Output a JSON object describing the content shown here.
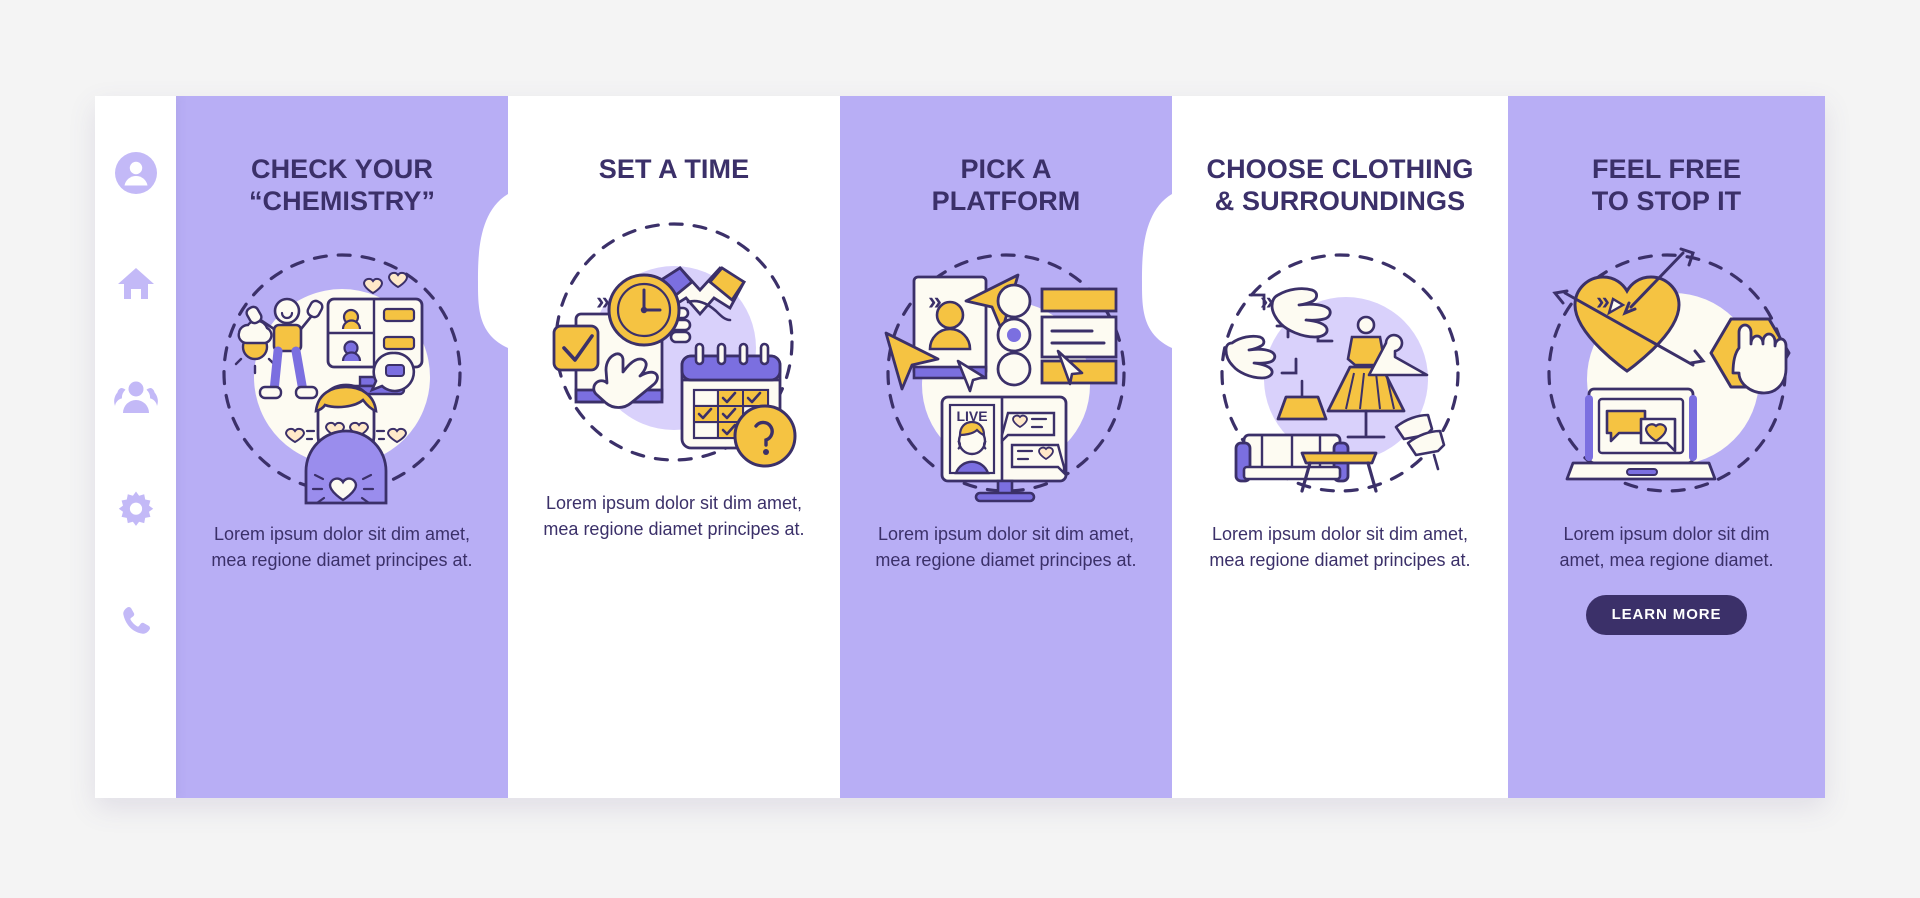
{
  "colors": {
    "page_bg": "#f4f4f4",
    "panel_purple": "#b8aef5",
    "panel_white": "#ffffff",
    "text_dark": "#3b3069",
    "accent_yellow": "#f5c342",
    "accent_purple": "#7b6fe0",
    "rail_icon": "#c3b9f7"
  },
  "sidebar": {
    "items": [
      {
        "name": "avatar-icon",
        "label": "Profile"
      },
      {
        "name": "home-icon",
        "label": "Home"
      },
      {
        "name": "people-icon",
        "label": "Community"
      },
      {
        "name": "gear-icon",
        "label": "Settings"
      },
      {
        "name": "phone-icon",
        "label": "Contact"
      }
    ]
  },
  "separator": {
    "glyph": "»"
  },
  "panels": [
    {
      "title": "CHECK YOUR\n“CHEMISTRY”",
      "title_line1": "CHECK YOUR",
      "title_line2": "“CHEMISTRY”",
      "desc": "Lorem ipsum dolor sit dim amet, mea regione diamet principes at.",
      "background": "purple",
      "art": "chemistry-illustration",
      "active_dot": 1,
      "dot_count": 5,
      "button": null
    },
    {
      "title": "SET A TIME",
      "title_line1": "SET A TIME",
      "title_line2": "",
      "desc": "Lorem ipsum dolor sit dim amet, mea regione diamet principes at.",
      "background": "white",
      "art": "set-a-time-illustration",
      "active_dot": 2,
      "dot_count": 5,
      "button": null
    },
    {
      "title": "PICK A\nPLATFORM",
      "title_line1": "PICK A",
      "title_line2": "PLATFORM",
      "desc": "Lorem ipsum dolor sit dim amet, mea regione diamet principes at.",
      "background": "purple",
      "art": "pick-a-platform-illustration",
      "active_dot": 3,
      "dot_count": 5,
      "button": null
    },
    {
      "title": "CHOOSE CLOTHING\n& SURROUNDINGS",
      "title_line1": "CHOOSE CLOTHING",
      "title_line2": "& SURROUNDINGS",
      "desc": "Lorem ipsum dolor sit dim amet, mea regione diamet principes at.",
      "background": "white",
      "art": "choose-clothing-illustration",
      "active_dot": 4,
      "dot_count": 5,
      "button": null
    },
    {
      "title": "FEEL FREE\nTO STOP IT",
      "title_line1": "FEEL FREE",
      "title_line2": "TO STOP IT",
      "desc": "Lorem ipsum dolor sit dim amet, mea regione diamet.",
      "background": "purple",
      "art": "feel-free-to-stop-illustration",
      "active_dot": 5,
      "dot_count": 5,
      "button": "LEARN MORE"
    }
  ]
}
